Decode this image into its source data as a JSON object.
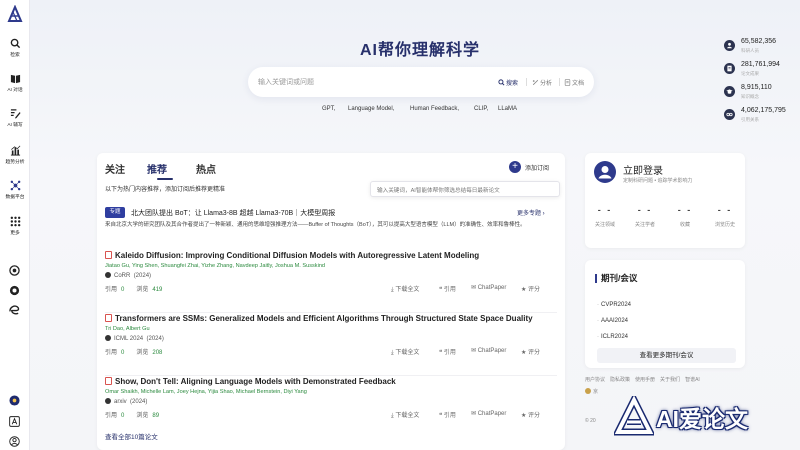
{
  "sidebar": {
    "items": [
      {
        "label": "检索",
        "icon": "search-icon"
      },
      {
        "label": "AI 对话",
        "icon": "book-icon"
      },
      {
        "label": "AI 辅写",
        "icon": "pen-icon"
      },
      {
        "label": "趋势分析",
        "icon": "bar-chart-icon"
      },
      {
        "label": "数据平台",
        "icon": "data-platform-icon"
      },
      {
        "label": "更多",
        "icon": "grid-icon"
      }
    ],
    "extensions": [
      "chrome-icon",
      "firefox-icon",
      "edge-icon"
    ],
    "bottom": [
      "sun-icon",
      "translate-icon",
      "user-icon"
    ]
  },
  "hero": {
    "title": "AI帮你理解科学",
    "search": {
      "placeholder": "输入关键词或问题",
      "actions": [
        "搜索",
        "分析",
        "文档"
      ]
    },
    "keywords": [
      "GPT,",
      "Language Model,",
      "Human Feedback,",
      "CLIP,",
      "LLaMA"
    ]
  },
  "stats": [
    {
      "num": "65,582,356",
      "cap": "科研人员"
    },
    {
      "num": "281,761,994",
      "cap": "论文成果"
    },
    {
      "num": "8,915,110",
      "cap": "知识概念"
    },
    {
      "num": "4,062,175,795",
      "cap": "引用关系"
    }
  ],
  "feed": {
    "tabs": [
      "关注",
      "推荐",
      "热点"
    ],
    "active_tab": 1,
    "note": "以下为热门内容推荐，添加订阅后推荐更精准",
    "add_sub": "添加订阅",
    "tooltip": "输入关键词，AI智能体帮你筛选总结每日最新论文",
    "topic": {
      "badge": "专题",
      "title": "北大团队提出 BoT：让 Llama3-8B 超越 Llama3-70B｜大模型周报",
      "more": "更多专题 ›",
      "desc": "来自北京大学的研究团队及其合作者提出了一种新颖、通用的思维增强推理方法——Buffer of Thoughts（BoT），其可以提高大型语言模型（LLM）的准确性、效率和鲁棒性。"
    },
    "papers": [
      {
        "title": "Kaleido Diffusion: Improving Conditional Diffusion Models with Autoregressive Latent Modeling",
        "authors": "Jiatao Gu, Ying Shen, Shuangfei Zhai, Yizhe Zhang, Navdeep Jaitly, Joshua M. Susskind",
        "venue": "CoRR",
        "year": "(2024)",
        "cite_label": "引用",
        "cite": "0",
        "view_label": "浏览",
        "views": "419"
      },
      {
        "title": "Transformers are SSMs: Generalized Models and Efficient Algorithms Through Structured State Space Duality",
        "authors": "Tri Dao, Albert Gu",
        "venue": "ICML 2024",
        "year": "(2024)",
        "cite_label": "引用",
        "cite": "0",
        "view_label": "浏览",
        "views": "208"
      },
      {
        "title": "Show, Don't Tell: Aligning Language Models with Demonstrated Feedback",
        "authors": "Omar Shaikh, Michelle Lam, Joey Hejna, Yijia Shao, Michael Bernstein, Diyi Yang",
        "venue": "arxiv",
        "year": "(2024)",
        "cite_label": "引用",
        "cite": "0",
        "view_label": "浏览",
        "views": "89"
      }
    ],
    "paper_actions": [
      "下载全文",
      "引用",
      "ChatPaper",
      "评分"
    ],
    "view_all": "查看全部10篇论文"
  },
  "login": {
    "title": "立即登录",
    "sub": "定制科研问题 • 追踪学术影响力",
    "stats": [
      {
        "n": "- -",
        "c": "关注领域"
      },
      {
        "n": "- -",
        "c": "关注学者"
      },
      {
        "n": "- -",
        "c": "收藏"
      },
      {
        "n": "- -",
        "c": "浏览历史"
      }
    ]
  },
  "journals": {
    "title": "期刊/会议",
    "items": [
      "CVPR2024",
      "AAAI2024",
      "ICLR2024"
    ],
    "more": "查看更多期刊/会议"
  },
  "footer": {
    "links": [
      "用户协议",
      "隐私政策",
      "使用手册",
      "关于我们",
      "智谱AI"
    ],
    "icp": "京",
    "copy": "© 20"
  },
  "watermark": {
    "text": "AI爱论文"
  },
  "colors": {
    "brand": "#27306b",
    "accent": "#2e3a8c",
    "green": "#2b8a3e",
    "pdf": "#d9534f"
  }
}
